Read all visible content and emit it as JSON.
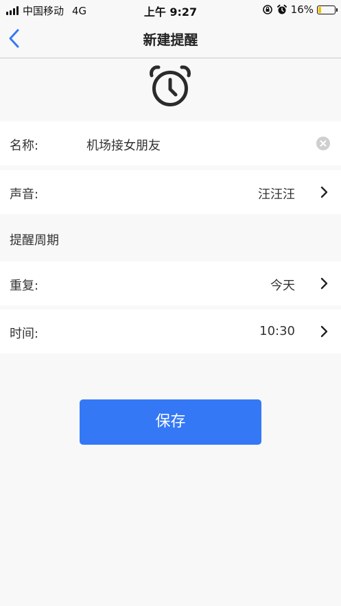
{
  "status_bar": {
    "carrier": "中国移动",
    "network": "4G",
    "time": "上午 9:27",
    "battery_percent": "16%",
    "battery_level": 0.16,
    "icons": [
      "signal-bars-icon",
      "orientation-lock-icon",
      "alarm-clock-icon",
      "battery-charging-icon"
    ]
  },
  "nav": {
    "title": "新建提醒",
    "back_icon": "chevron-left-icon"
  },
  "header_icon": "alarm-clock-icon",
  "form": {
    "name": {
      "label": "名称:",
      "value": "机场接女朋友",
      "clear_icon": "clear-circle-icon"
    },
    "sound": {
      "label": "声音:",
      "value": "汪汪汪",
      "icon": "chevron-right-icon"
    },
    "period_section": "提醒周期",
    "repeat": {
      "label": "重复:",
      "value": "今天",
      "icon": "chevron-right-icon"
    },
    "time": {
      "label": "时间:",
      "value": "10:30",
      "icon": "chevron-right-icon"
    }
  },
  "actions": {
    "save_label": "保存"
  },
  "colors": {
    "accent": "#3478f6",
    "background": "#f8f8f8",
    "row_background": "#ffffff",
    "battery_low": "#f2c200"
  }
}
